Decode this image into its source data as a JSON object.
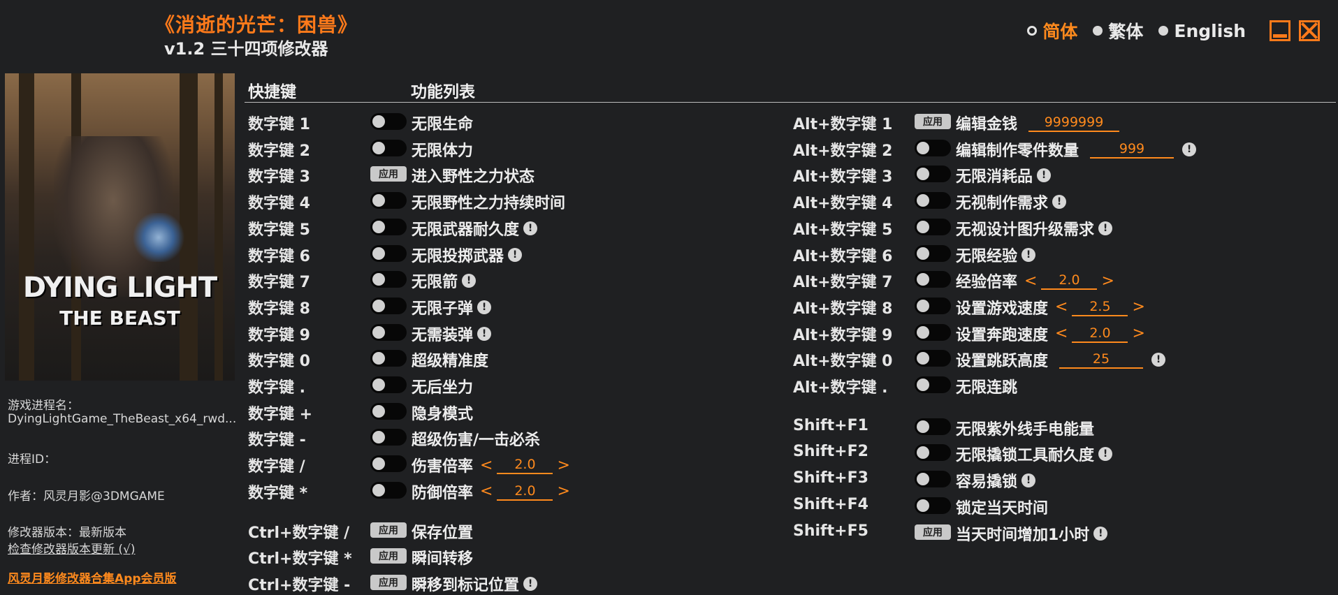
{
  "title": "《消逝的光芒：困兽》",
  "subtitle": "v1.2 三十四项修改器",
  "languages": [
    {
      "label": "简体",
      "selected": true
    },
    {
      "label": "繁体",
      "selected": false
    },
    {
      "label": "English",
      "selected": false
    }
  ],
  "cover": {
    "line1": "DYING LIGHT",
    "line2": "THE BEAST"
  },
  "info": {
    "process_label": "游戏进程名：",
    "process_value": "DyingLightGame_TheBeast_x64_rwd...",
    "pid_label": "进程ID：",
    "author": "作者：风灵月影@3DMGAME",
    "version": "修改器版本：最新版本",
    "check_update": "检查修改器版本更新 (√)",
    "app_link": "风灵月影修改器合集App会员版"
  },
  "headers": {
    "hotkey": "快捷键",
    "features": "功能列表"
  },
  "apply_label": "应用",
  "warn_glyph": "!",
  "arrow_left": "<",
  "arrow_right": ">",
  "left_rows": [
    {
      "key": "数字键 1",
      "ctrl": "toggle",
      "label": "无限生命"
    },
    {
      "key": "数字键 2",
      "ctrl": "toggle",
      "label": "无限体力"
    },
    {
      "key": "数字键 3",
      "ctrl": "apply",
      "label": "进入野性之力状态"
    },
    {
      "key": "数字键 4",
      "ctrl": "toggle",
      "label": "无限野性之力持续时间"
    },
    {
      "key": "数字键 5",
      "ctrl": "toggle",
      "label": "无限武器耐久度",
      "warn": true
    },
    {
      "key": "数字键 6",
      "ctrl": "toggle",
      "label": "无限投掷武器",
      "warn": true
    },
    {
      "key": "数字键 7",
      "ctrl": "toggle",
      "label": "无限箭",
      "warn": true
    },
    {
      "key": "数字键 8",
      "ctrl": "toggle",
      "label": "无限子弹",
      "warn": true
    },
    {
      "key": "数字键 9",
      "ctrl": "toggle",
      "label": "无需装弹",
      "warn": true
    },
    {
      "key": "数字键 0",
      "ctrl": "toggle",
      "label": "超级精准度"
    },
    {
      "key": "数字键 .",
      "ctrl": "toggle",
      "label": "无后坐力"
    },
    {
      "key": "数字键 +",
      "ctrl": "toggle",
      "label": "隐身模式"
    },
    {
      "key": "数字键 -",
      "ctrl": "toggle",
      "label": "超级伤害/一击必杀"
    },
    {
      "key": "数字键 /",
      "ctrl": "toggle",
      "label": "伤害倍率",
      "value": "2.0",
      "arrows": true
    },
    {
      "key": "数字键 *",
      "ctrl": "toggle",
      "label": "防御倍率",
      "value": "2.0",
      "arrows": true
    },
    {
      "key": "Ctrl+数字键 /",
      "ctrl": "apply",
      "label": "保存位置",
      "gap": true
    },
    {
      "key": "Ctrl+数字键 *",
      "ctrl": "apply",
      "label": "瞬间转移"
    },
    {
      "key": "Ctrl+数字键 -",
      "ctrl": "apply",
      "label": "瞬移到标记位置",
      "warn": true
    }
  ],
  "right_rows": [
    {
      "key": "Alt+数字键 1",
      "ctrl": "apply",
      "label": "编辑金钱",
      "value": "9999999"
    },
    {
      "key": "Alt+数字键 2",
      "ctrl": "toggle",
      "label": "编辑制作零件数量",
      "value": "999",
      "warn": true
    },
    {
      "key": "Alt+数字键 3",
      "ctrl": "toggle",
      "label": "无限消耗品",
      "warn": true
    },
    {
      "key": "Alt+数字键 4",
      "ctrl": "toggle",
      "label": "无视制作需求",
      "warn": true
    },
    {
      "key": "Alt+数字键 5",
      "ctrl": "toggle",
      "label": "无视设计图升级需求",
      "warn": true
    },
    {
      "key": "Alt+数字键 6",
      "ctrl": "toggle",
      "label": "无限经验",
      "warn": true
    },
    {
      "key": "Alt+数字键 7",
      "ctrl": "toggle",
      "label": "经验倍率",
      "value": "2.0",
      "arrows": true
    },
    {
      "key": "Alt+数字键 8",
      "ctrl": "toggle",
      "label": "设置游戏速度",
      "value": "2.5",
      "arrows": true
    },
    {
      "key": "Alt+数字键 9",
      "ctrl": "toggle",
      "label": "设置奔跑速度",
      "value": "2.0",
      "arrows": true
    },
    {
      "key": "Alt+数字键 0",
      "ctrl": "toggle",
      "label": "设置跳跃高度",
      "value": "25",
      "warn": true
    },
    {
      "key": "Alt+数字键 .",
      "ctrl": "toggle",
      "label": "无限连跳"
    },
    {
      "key": "Shift+F1",
      "ctrl": "toggle",
      "label": "无限紫外线手电能量",
      "gap": true
    },
    {
      "key": "Shift+F2",
      "ctrl": "toggle",
      "label": "无限撬锁工具耐久度",
      "warn": true
    },
    {
      "key": "Shift+F3",
      "ctrl": "toggle",
      "label": "容易撬锁",
      "warn": true
    },
    {
      "key": "Shift+F4",
      "ctrl": "toggle",
      "label": "锁定当天时间"
    },
    {
      "key": "Shift+F5",
      "ctrl": "apply",
      "label": "当天时间增加1小时",
      "warn": true
    }
  ]
}
